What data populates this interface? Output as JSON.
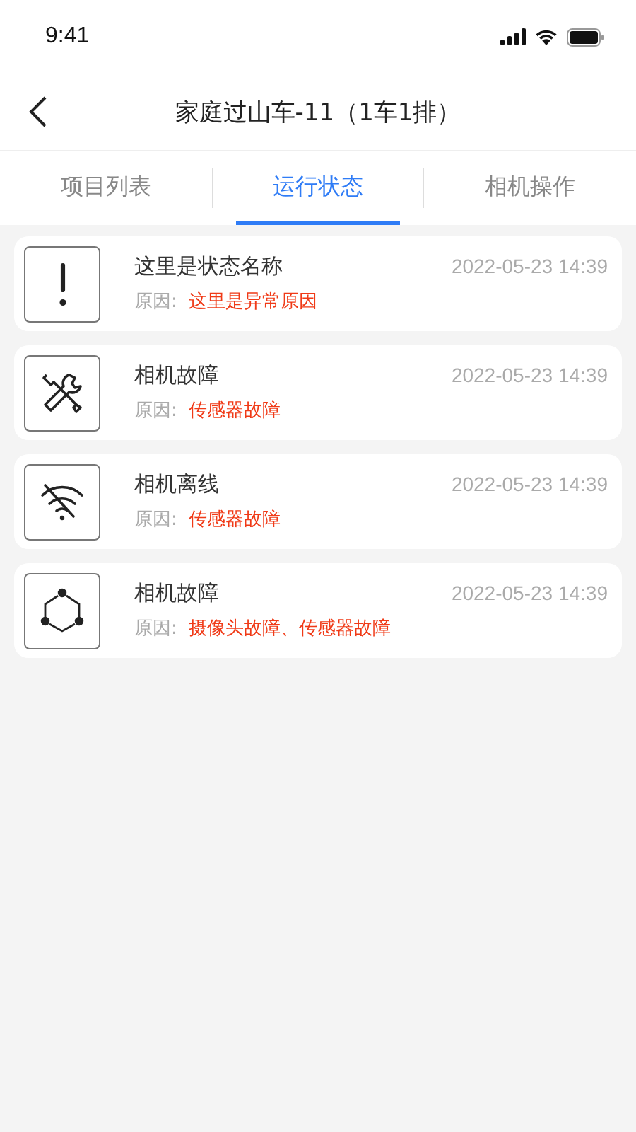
{
  "status_bar": {
    "time": "9:41"
  },
  "header": {
    "title": "家庭过山车-11（1车1排）"
  },
  "tabs": [
    {
      "label": "项目列表",
      "selected": false
    },
    {
      "label": "运行状态",
      "selected": true
    },
    {
      "label": "相机操作",
      "selected": false
    }
  ],
  "events": [
    {
      "kind": "alert",
      "name": "这里是状态名称",
      "time": "2022-05-23 14:39",
      "reason_label": "原因:",
      "reason": "这里是异常原因"
    },
    {
      "kind": "tools",
      "name": "相机故障",
      "time": "2022-05-23 14:39",
      "reason_label": "原因:",
      "reason": "传感器故障"
    },
    {
      "kind": "offline",
      "name": "相机离线",
      "time": "2022-05-23 14:39",
      "reason_label": "原因:",
      "reason": "传感器故障"
    },
    {
      "kind": "nodes",
      "name": "相机故障",
      "time": "2022-05-23 14:39",
      "reason_label": "原因:",
      "reason": "摄像头故障、传感器故障"
    }
  ]
}
